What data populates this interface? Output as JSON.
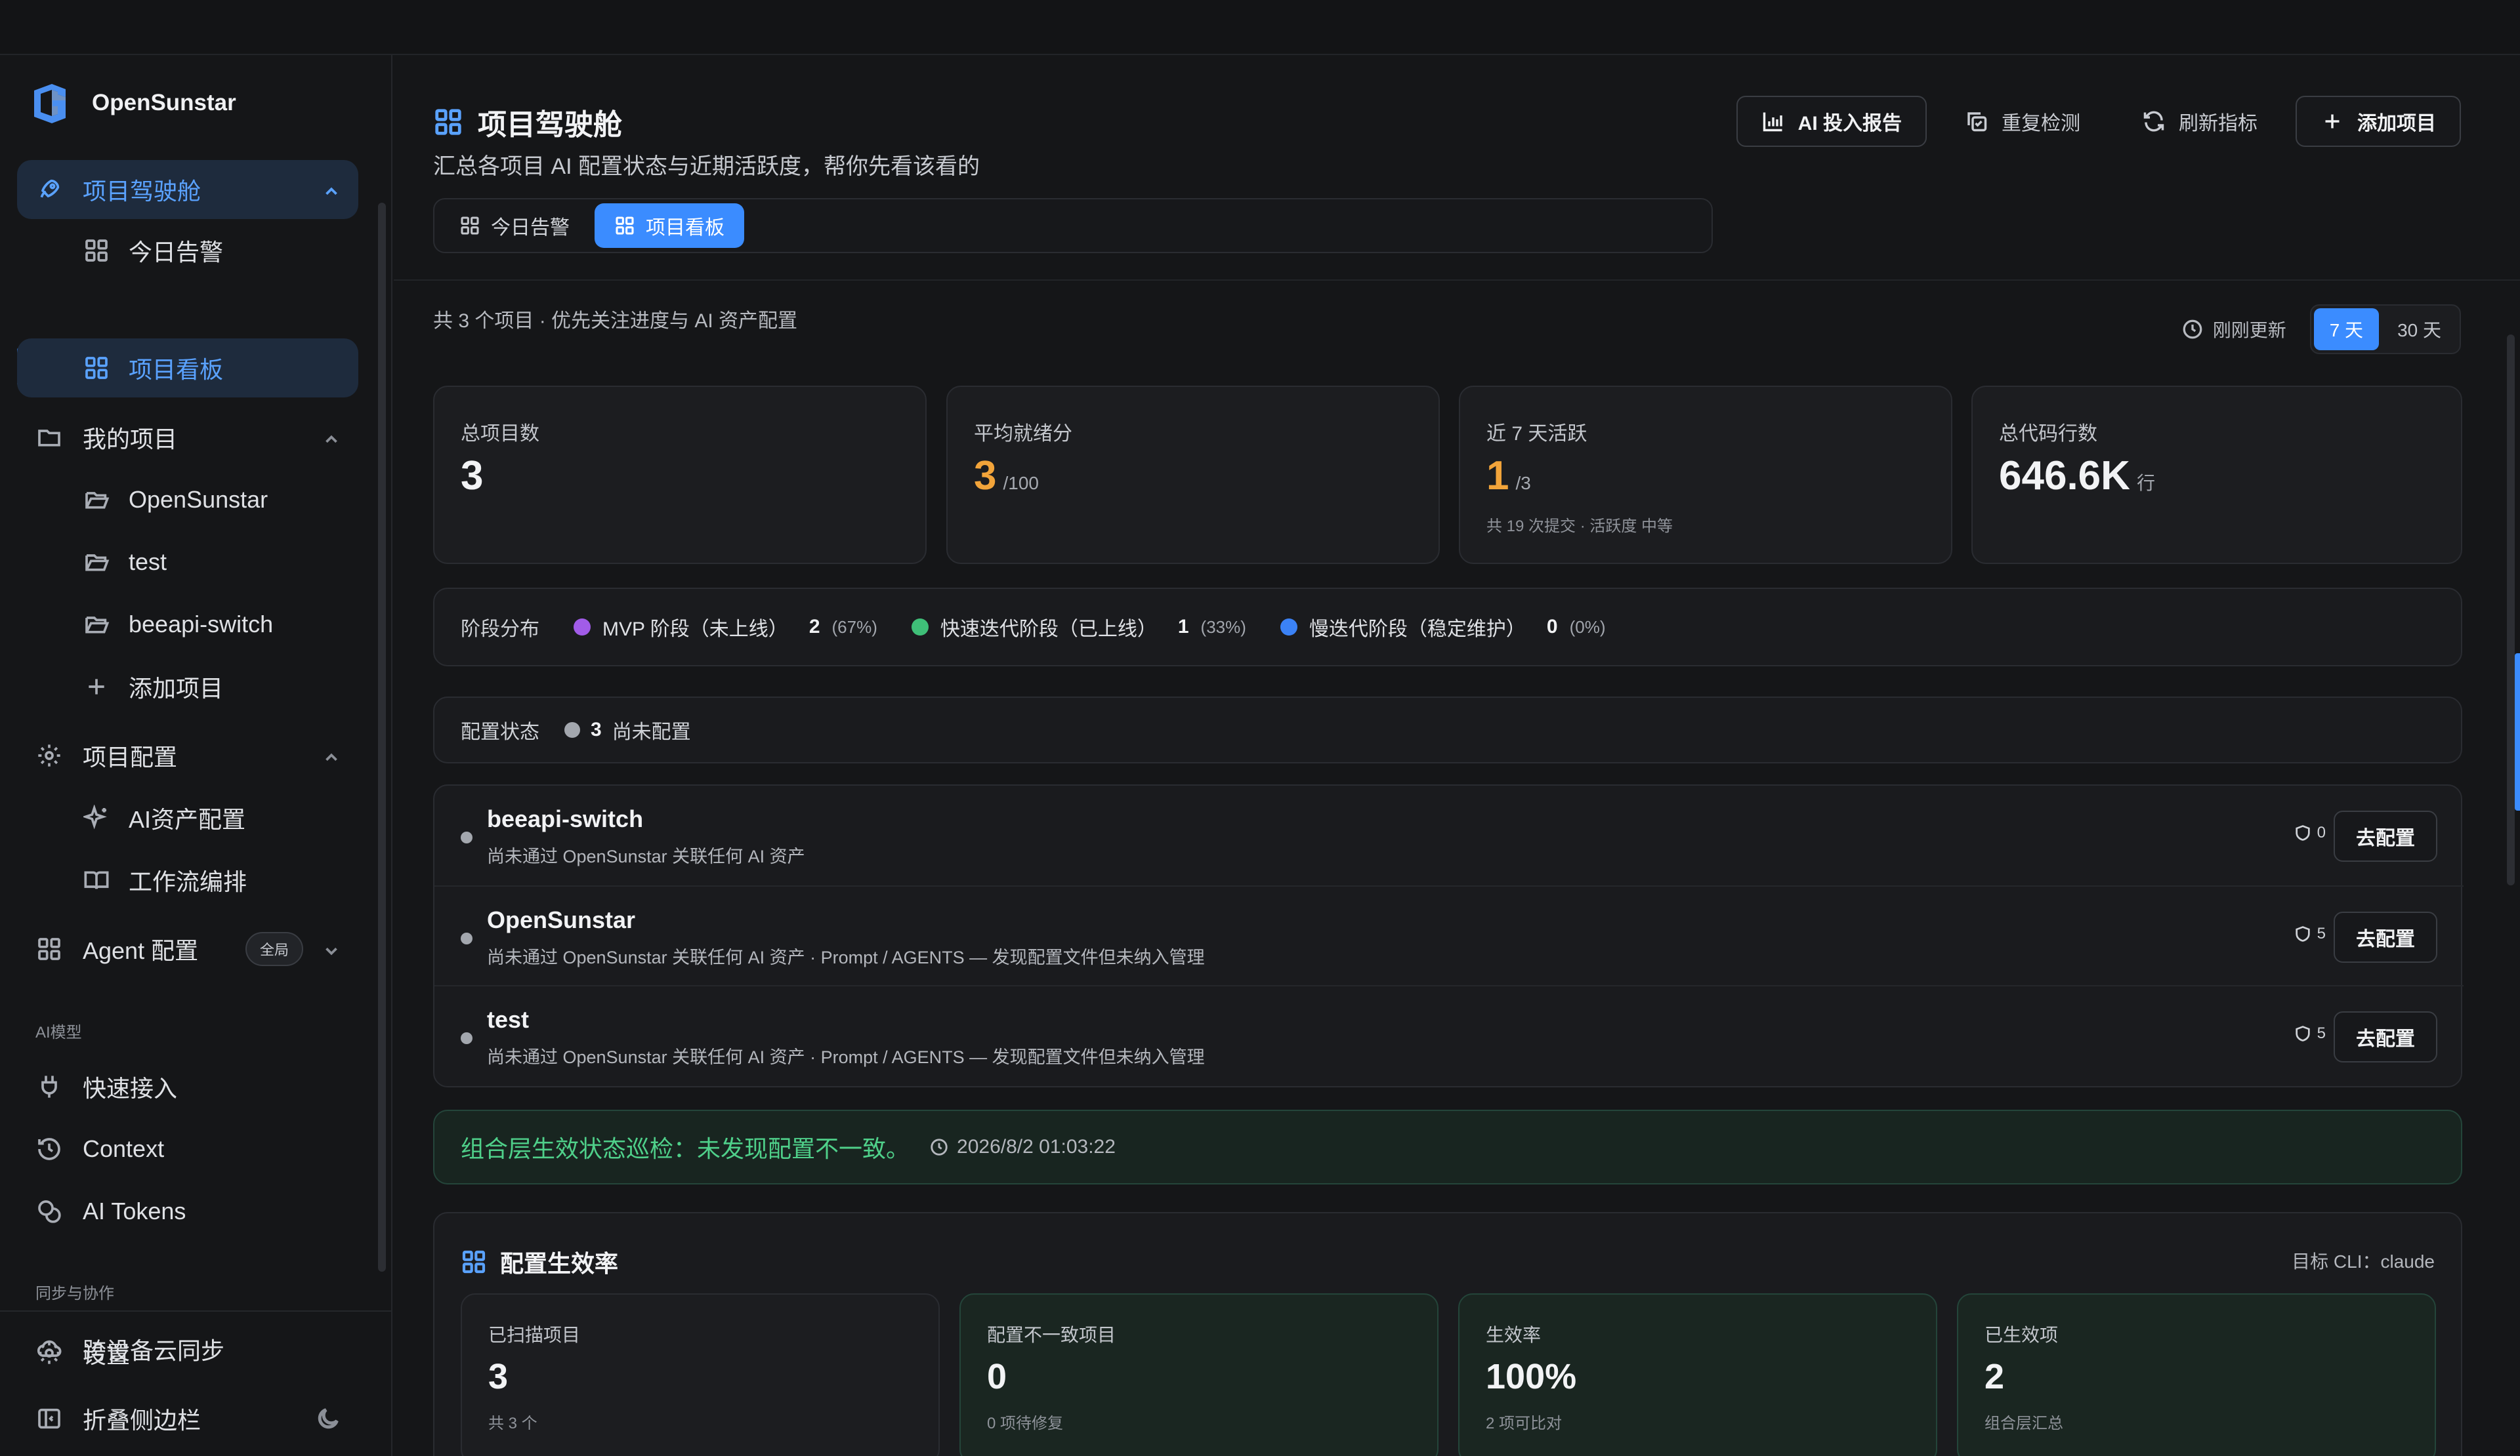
{
  "brand": {
    "name": "OpenSunstar"
  },
  "sidebar": {
    "groups": [
      {
        "label": "项目驾驶舱",
        "icon": "rocket-icon",
        "active": true
      },
      {
        "label": "我的项目",
        "icon": "folder-icon"
      },
      {
        "label": "项目配置",
        "icon": "gear-icon"
      },
      {
        "label": "Agent 配置",
        "icon": "grid-icon",
        "badge": "全局"
      }
    ],
    "cockpit_items": [
      {
        "label": "今日告警",
        "icon": "grid-icon"
      },
      {
        "label": "项目看板",
        "icon": "grid-icon",
        "active": true
      }
    ],
    "project_items": [
      {
        "label": "OpenSunstar",
        "icon": "folder-open-icon"
      },
      {
        "label": "test",
        "icon": "folder-open-icon"
      },
      {
        "label": "beeapi-switch",
        "icon": "folder-open-icon"
      },
      {
        "label": "添加项目",
        "icon": "plus-icon"
      }
    ],
    "config_items": [
      {
        "label": "AI资产配置",
        "icon": "sparkles-icon"
      },
      {
        "label": "工作流编排",
        "icon": "book-icon"
      }
    ],
    "section_ai": "AI模型",
    "ai_items": [
      {
        "label": "快速接入",
        "icon": "plug-icon"
      },
      {
        "label": "Context",
        "icon": "history-icon"
      },
      {
        "label": "AI Tokens",
        "icon": "coins-icon"
      }
    ],
    "section_sync": "同步与协作",
    "sync_items": [
      {
        "label": "跨设备云同步",
        "icon": "cloud-icon"
      }
    ],
    "bottom": {
      "settings": "设置",
      "collapse": "折叠侧边栏"
    }
  },
  "header": {
    "title": "项目驾驶舱",
    "subtitle": "汇总各项目 AI 配置状态与近期活跃度，帮你先看该看的",
    "actions": {
      "report": "AI 投入报告",
      "recheck": "重复检测",
      "refresh": "刷新指标",
      "add": "添加项目"
    },
    "tabs": [
      {
        "label": "今日告警"
      },
      {
        "label": "项目看板",
        "active": true
      }
    ]
  },
  "summary": {
    "text": "共 3 个项目 · 优先关注进度与 AI 资产配置",
    "updated": "刚刚更新",
    "ranges": [
      "7 天",
      "30 天"
    ],
    "selected_range": "7 天"
  },
  "stats": [
    {
      "label": "总项目数",
      "value": "3",
      "unit": "",
      "note": ""
    },
    {
      "label": "平均就绪分",
      "value": "3",
      "unit": "/100",
      "note": ""
    },
    {
      "label": "近 7 天活跃",
      "value": "1",
      "unit": "/3",
      "note": "共 19 次提交 · 活跃度 中等"
    },
    {
      "label": "总代码行数",
      "value": "646.6K",
      "unit": "行",
      "note": ""
    }
  ],
  "stages": {
    "label": "阶段分布",
    "items": [
      {
        "name": "MVP 阶段（未上线）",
        "count": "2",
        "pct": "(67%)",
        "color": "#a15ce8"
      },
      {
        "name": "快速迭代阶段（已上线）",
        "count": "1",
        "pct": "(33%)",
        "color": "#3fbf78"
      },
      {
        "name": "慢迭代阶段（稳定维护）",
        "count": "0",
        "pct": "(0%)",
        "color": "#3b82f6"
      }
    ]
  },
  "config_status": {
    "label": "配置状态",
    "count": "3",
    "text": "尚未配置"
  },
  "projects": [
    {
      "name": "beeapi-switch",
      "desc": "尚未通过 OpenSunstar 关联任何 AI 资产",
      "shield": "0",
      "action": "去配置"
    },
    {
      "name": "OpenSunstar",
      "desc": "尚未通过 OpenSunstar 关联任何 AI 资产 · Prompt / AGENTS — 发现配置文件但未纳入管理",
      "shield": "5",
      "action": "去配置"
    },
    {
      "name": "test",
      "desc": "尚未通过 OpenSunstar 关联任何 AI 资产 · Prompt / AGENTS — 发现配置文件但未纳入管理",
      "shield": "5",
      "action": "去配置"
    }
  ],
  "inspection": {
    "text": "组合层生效状态巡检：未发现配置不一致。",
    "time": "2026/8/2 01:03:22"
  },
  "effectiveness": {
    "title": "配置生效率",
    "target": "目标 CLI：claude",
    "cards": [
      {
        "label": "已扫描项目",
        "value": "3",
        "note": "共 3 个"
      },
      {
        "label": "配置不一致项目",
        "value": "0",
        "note": "0 项待修复"
      },
      {
        "label": "生效率",
        "value": "100%",
        "note": "2 项可比对"
      },
      {
        "label": "已生效项",
        "value": "2",
        "note": "组合层汇总"
      }
    ]
  },
  "colors": {
    "accent": "#3b8cff",
    "warning": "#f2a43a",
    "success": "#4fd08a"
  }
}
